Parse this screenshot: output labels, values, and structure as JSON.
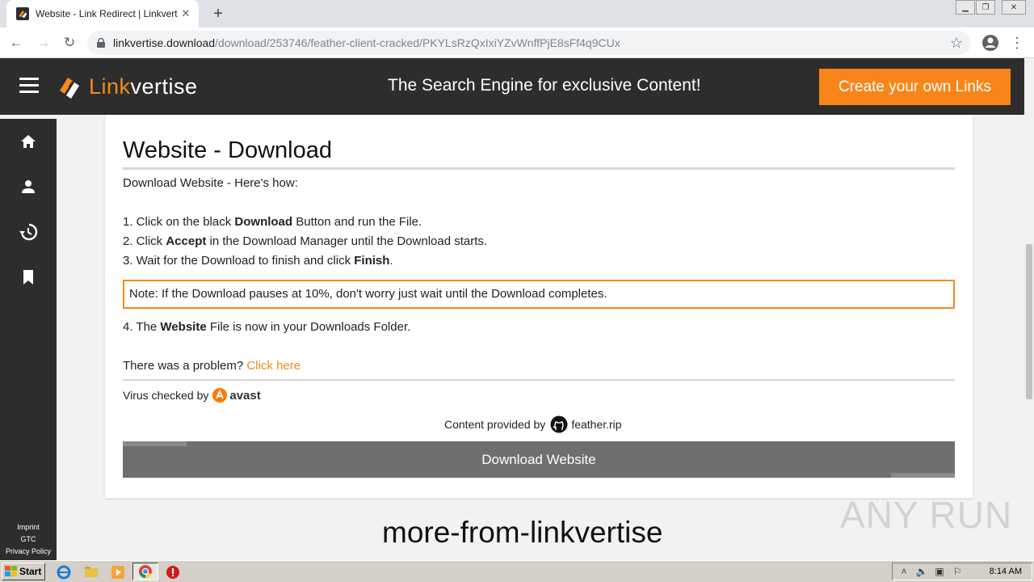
{
  "browser": {
    "tab_title": "Website - Link Redirect | Linkvertise",
    "new_tab": "+",
    "url_domain": "linkvertise.download",
    "url_path": "/download/253746/feather-client-cracked/PKYLsRzQxIxiYZvWnffPjE8sFf4q9CUx"
  },
  "header": {
    "logo_part1": "Link",
    "logo_part2": "vertise",
    "tagline": "The Search Engine for exclusive Content!",
    "create_button": "Create your own Links"
  },
  "sidebar": {
    "icons": [
      "home-icon",
      "user-icon",
      "history-icon",
      "bookmark-icon"
    ],
    "footer": [
      "Imprint",
      "GTC",
      "Privacy Policy"
    ]
  },
  "card": {
    "title": "Website - Download",
    "intro": "Download Website - Here's how:",
    "step1_a": "1. Click on the black ",
    "step1_b": "Download",
    "step1_c": " Button and run the File.",
    "step2_a": "2. Click ",
    "step2_b": "Accept",
    "step2_c": " in the Download Manager until the Download starts.",
    "step3_a": "3. Wait for the Download to finish and click ",
    "step3_b": "Finish",
    "step3_c": ".",
    "note": "Note: If the Download pauses at 10%, don't worry just wait until the Download completes.",
    "step4_a": "4. The ",
    "step4_b": "Website",
    "step4_c": " File is now in your Downloads Folder.",
    "problem": "There was a problem? ",
    "problem_link": "Click here",
    "virus_checked": "Virus checked by",
    "avast": "avast",
    "content_provided": "Content provided by",
    "provider": "feather.rip",
    "download_button": "Download Website"
  },
  "more_title": "more-from-linkvertise",
  "watermark": "ANY RUN",
  "taskbar": {
    "start": "Start",
    "clock": "8:14 AM"
  },
  "colors": {
    "accent": "#f28b19",
    "header_bg": "#2d2d2d",
    "button_gray": "#6f6f6f"
  }
}
